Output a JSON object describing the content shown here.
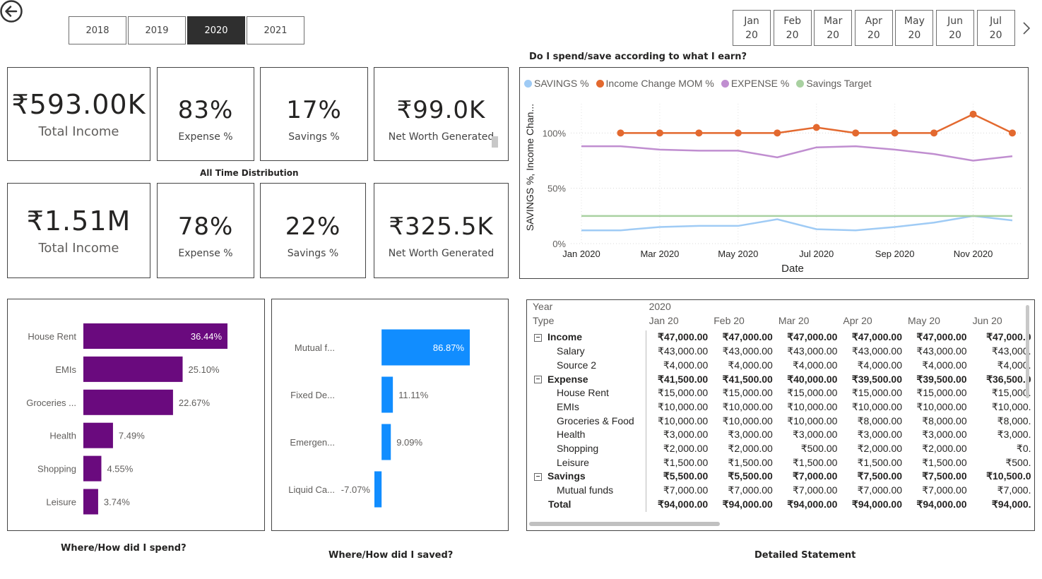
{
  "years": [
    {
      "label": "2018",
      "selected": false
    },
    {
      "label": "2019",
      "selected": false
    },
    {
      "label": "2020",
      "selected": true
    },
    {
      "label": "2021",
      "selected": false
    }
  ],
  "months": [
    {
      "m": "Jan",
      "y": "20"
    },
    {
      "m": "Feb",
      "y": "20"
    },
    {
      "m": "Mar",
      "y": "20"
    },
    {
      "m": "Apr",
      "y": "20"
    },
    {
      "m": "May",
      "y": "20"
    },
    {
      "m": "Jun",
      "y": "20"
    },
    {
      "m": "Jul",
      "y": "20"
    }
  ],
  "kpi_year": {
    "total_income": {
      "value": "₹593.00K",
      "label": "Total Income"
    },
    "expense": {
      "value": "83%",
      "label": "Expense %"
    },
    "savings": {
      "value": "17%",
      "label": "Savings %"
    },
    "net_worth": {
      "value": "₹99.0K",
      "label": "Net Worth Generated"
    }
  },
  "all_time_caption": "All Time Distribution",
  "kpi_all": {
    "total_income": {
      "value": "₹1.51M",
      "label": "Total Income"
    },
    "expense": {
      "value": "78%",
      "label": "Expense %"
    },
    "savings": {
      "value": "22%",
      "label": "Savings %"
    },
    "net_worth": {
      "value": "₹325.5K",
      "label": "Net Worth Generated"
    }
  },
  "line_chart_title": "Do I spend/save according to what I earn?",
  "spend_caption": "Where/How did I spend?",
  "save_caption": "Where/How did I saved?",
  "statement_caption": "Detailed Statement",
  "colors": {
    "purple": "#6a0a7e",
    "blue": "#118dff",
    "savings": "#9fcbf5",
    "income": "#e3692f",
    "expense": "#c08ed0",
    "target": "#a9d1a1"
  },
  "chart_data": [
    {
      "type": "line",
      "title": "Do I spend/save according to what I earn?",
      "xlabel": "Date",
      "ylabel": "SAVINGS %, Income Chan...",
      "x": [
        "Jan 2020",
        "Feb 2020",
        "Mar 2020",
        "Apr 2020",
        "May 2020",
        "Jun 2020",
        "Jul 2020",
        "Aug 2020",
        "Sep 2020",
        "Oct 2020",
        "Nov 2020",
        "Dec 2020"
      ],
      "x_ticks": [
        "Jan 2020",
        "Mar 2020",
        "May 2020",
        "Jul 2020",
        "Sep 2020",
        "Nov 2020"
      ],
      "y_ticks": [
        "0%",
        "50%",
        "100%"
      ],
      "ylim": [
        0,
        120
      ],
      "grid": true,
      "legend": "top-left",
      "series": [
        {
          "name": "SAVINGS %",
          "color": "#9fcbf5",
          "markers": false,
          "values": [
            12,
            12,
            15,
            16,
            16,
            22,
            13,
            12,
            15,
            19,
            25,
            21
          ]
        },
        {
          "name": "Income Change MOM %",
          "color": "#e3692f",
          "markers": true,
          "values": [
            null,
            100,
            100,
            100,
            100,
            100,
            105,
            100,
            100,
            100,
            117,
            100
          ]
        },
        {
          "name": "EXPENSE %",
          "color": "#c08ed0",
          "markers": false,
          "values": [
            88,
            88,
            85,
            84,
            84,
            78,
            87,
            88,
            85,
            81,
            75,
            79
          ]
        },
        {
          "name": "Savings Target",
          "color": "#a9d1a1",
          "markers": false,
          "values": [
            25,
            25,
            25,
            25,
            25,
            25,
            25,
            25,
            25,
            25,
            25,
            25
          ]
        }
      ]
    },
    {
      "type": "bar",
      "orientation": "horizontal",
      "title": "Where/How did I spend?",
      "categories": [
        "House Rent",
        "EMIs",
        "Groceries ...",
        "Health",
        "Shopping",
        "Leisure"
      ],
      "values": [
        36.44,
        25.1,
        22.67,
        7.49,
        4.55,
        3.74
      ],
      "labels": [
        "36.44%",
        "25.10%",
        "22.67%",
        "7.49%",
        "4.55%",
        "3.74%"
      ],
      "xlim": [
        0,
        36.44
      ],
      "color": "#6a0a7e"
    },
    {
      "type": "bar",
      "orientation": "horizontal",
      "title": "Where/How did I saved?",
      "categories": [
        "Mutual f...",
        "Fixed De...",
        "Emergen...",
        "Liquid Ca..."
      ],
      "values": [
        86.87,
        11.11,
        9.09,
        -7.07
      ],
      "labels": [
        "86.87%",
        "11.11%",
        "9.09%",
        "-7.07%"
      ],
      "xlim": [
        -7.07,
        86.87
      ],
      "color": "#118dff"
    }
  ],
  "statement": {
    "year_label": "Year",
    "type_label": "Type",
    "year": "2020",
    "columns": [
      "Jan 20",
      "Feb 20",
      "Mar 20",
      "Apr 20",
      "May 20",
      "Jun 20"
    ],
    "rows": [
      {
        "label": "Income",
        "group": true,
        "vals": [
          "₹47,000.00",
          "₹47,000.00",
          "₹47,000.00",
          "₹47,000.00",
          "₹47,000.00",
          "₹47,000.0"
        ]
      },
      {
        "label": "Salary",
        "vals": [
          "₹43,000.00",
          "₹43,000.00",
          "₹43,000.00",
          "₹43,000.00",
          "₹43,000.00",
          "₹43,000."
        ]
      },
      {
        "label": "Source 2",
        "vals": [
          "₹4,000.00",
          "₹4,000.00",
          "₹4,000.00",
          "₹4,000.00",
          "₹4,000.00",
          "₹4,000."
        ]
      },
      {
        "label": "Expense",
        "group": true,
        "vals": [
          "₹41,500.00",
          "₹41,500.00",
          "₹40,000.00",
          "₹39,500.00",
          "₹39,500.00",
          "₹36,500.0"
        ]
      },
      {
        "label": "House Rent",
        "vals": [
          "₹15,000.00",
          "₹15,000.00",
          "₹15,000.00",
          "₹15,000.00",
          "₹15,000.00",
          "₹15,000."
        ]
      },
      {
        "label": "EMIs",
        "vals": [
          "₹10,000.00",
          "₹10,000.00",
          "₹10,000.00",
          "₹10,000.00",
          "₹10,000.00",
          "₹10,000."
        ]
      },
      {
        "label": "Groceries & Food",
        "vals": [
          "₹10,000.00",
          "₹10,000.00",
          "₹10,000.00",
          "₹8,000.00",
          "₹8,000.00",
          "₹8,000."
        ]
      },
      {
        "label": "Health",
        "vals": [
          "₹3,000.00",
          "₹3,000.00",
          "₹3,000.00",
          "₹3,000.00",
          "₹3,000.00",
          "₹3,000."
        ]
      },
      {
        "label": "Shopping",
        "vals": [
          "₹2,000.00",
          "₹2,000.00",
          "₹500.00",
          "₹2,000.00",
          "₹2,000.00",
          "₹0."
        ]
      },
      {
        "label": "Leisure",
        "vals": [
          "₹1,500.00",
          "₹1,500.00",
          "₹1,500.00",
          "₹1,500.00",
          "₹1,500.00",
          "₹500."
        ]
      },
      {
        "label": "Savings",
        "group": true,
        "vals": [
          "₹5,500.00",
          "₹5,500.00",
          "₹7,000.00",
          "₹7,500.00",
          "₹7,500.00",
          "₹10,500.0"
        ]
      },
      {
        "label": "Mutual funds",
        "vals": [
          "₹7,000.00",
          "₹7,000.00",
          "₹7,000.00",
          "₹7,000.00",
          "₹7,000.00",
          "₹7,000."
        ]
      },
      {
        "label": "Total",
        "total": true,
        "vals": [
          "₹94,000.00",
          "₹94,000.00",
          "₹94,000.00",
          "₹94,000.00",
          "₹94,000.00",
          "₹94,000."
        ]
      }
    ]
  }
}
